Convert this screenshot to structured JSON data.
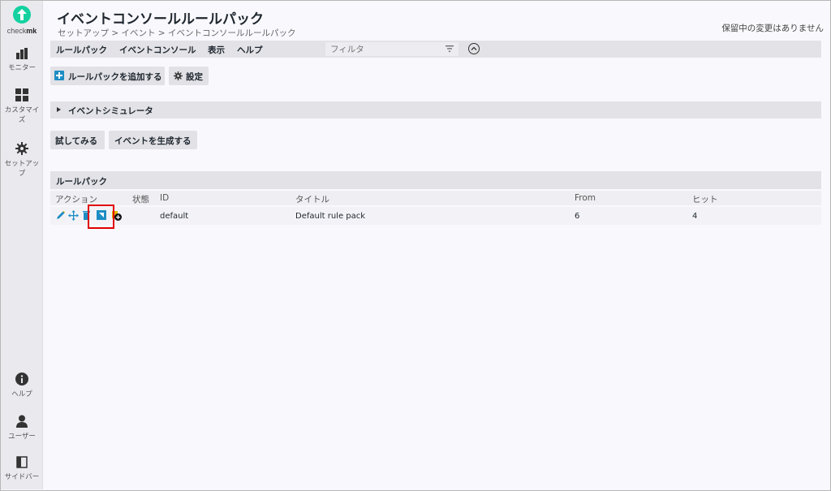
{
  "sidebar": {
    "logo": {
      "text_a": "check",
      "text_b": "mk"
    },
    "items": [
      {
        "label": "モニター",
        "icon": "bar-chart-icon"
      },
      {
        "label": "カスタマイズ",
        "icon": "grid-icon"
      },
      {
        "label": "セットアップ",
        "icon": "gear-icon"
      },
      {
        "label": "ヘルプ",
        "icon": "info-icon"
      },
      {
        "label": "ユーザー",
        "icon": "user-icon"
      },
      {
        "label": "サイドバー",
        "icon": "sidebar-icon"
      }
    ]
  },
  "header": {
    "title": "イベントコンソールルールパック",
    "breadcrumb": "セットアップ > イベント > イベントコンソールルールパック",
    "pending": "保留中の変更はありません"
  },
  "menubar": {
    "items": [
      "ルールパック",
      "イベントコンソール",
      "表示",
      "ヘルプ"
    ],
    "filter_placeholder": "フィルタ"
  },
  "toolbar": {
    "add_label": "ルールパックを追加する",
    "settings_label": "設定"
  },
  "simulator": {
    "label": "イベントシミュレータ"
  },
  "sim_buttons": {
    "try_label": "試してみる",
    "generate_label": "イベントを生成する"
  },
  "table": {
    "title": "ルールパック",
    "columns": [
      "アクション",
      "状態",
      "ID",
      "タイトル",
      "From",
      "ヒット"
    ],
    "rows": [
      {
        "id": "default",
        "title": "Default rule pack",
        "from": "6",
        "hits": "4"
      }
    ]
  },
  "colors": {
    "accent": "#15d1a0",
    "highlight": "#e00000",
    "icon_blue": "#1e8dc4"
  }
}
